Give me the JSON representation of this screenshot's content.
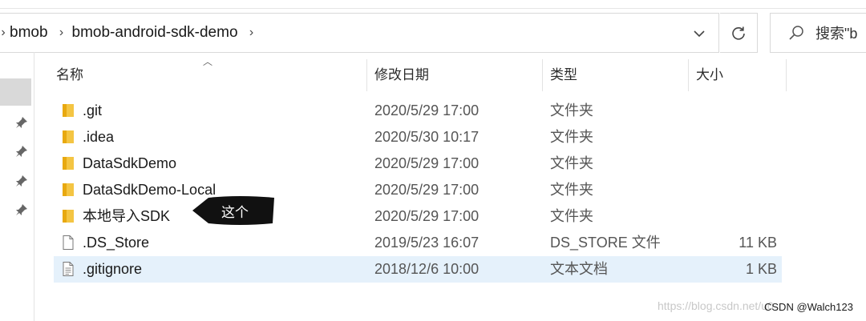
{
  "address_bar": {
    "breadcrumbs": [
      "bmob",
      "bmob-android-sdk-demo"
    ]
  },
  "search": {
    "placeholder": "搜索\"b"
  },
  "columns": {
    "name": "名称",
    "date": "修改日期",
    "type": "类型",
    "size": "大小"
  },
  "files": [
    {
      "name": ".git",
      "date": "2020/5/29 17:00",
      "type": "文件夹",
      "size": "",
      "icon": "folder-icon"
    },
    {
      "name": ".idea",
      "date": "2020/5/30 10:17",
      "type": "文件夹",
      "size": "",
      "icon": "folder-icon"
    },
    {
      "name": "DataSdkDemo",
      "date": "2020/5/29 17:00",
      "type": "文件夹",
      "size": "",
      "icon": "folder-icon"
    },
    {
      "name": "DataSdkDemo-Local",
      "date": "2020/5/29 17:00",
      "type": "文件夹",
      "size": "",
      "icon": "folder-icon"
    },
    {
      "name": "本地导入SDK",
      "date": "2020/5/29 17:00",
      "type": "文件夹",
      "size": "",
      "icon": "folder-icon"
    },
    {
      "name": ".DS_Store",
      "date": "2019/5/23 16:07",
      "type": "DS_STORE 文件",
      "size": "11 KB",
      "icon": "file-icon"
    },
    {
      "name": ".gitignore",
      "date": "2018/12/6 10:00",
      "type": "文本文档",
      "size": "1 KB",
      "icon": "text-file-icon"
    }
  ],
  "annotation": {
    "label": "这个"
  },
  "watermark": {
    "text": "https://blog.csdn.net/u0"
  },
  "credit": {
    "text": "CSDN @Walch123"
  },
  "colors": {
    "folder": "#f4c543",
    "selected_row": "#e5f1fb",
    "annotation_bg": "#111111"
  }
}
